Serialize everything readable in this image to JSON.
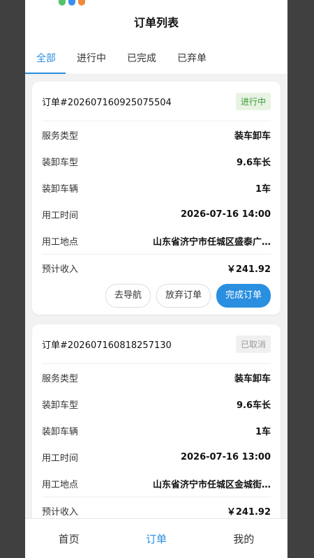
{
  "header": {
    "title": "订单列表"
  },
  "tabs": [
    {
      "label": "全部",
      "active": true
    },
    {
      "label": "进行中",
      "active": false
    },
    {
      "label": "已完成",
      "active": false
    },
    {
      "label": "已弃单",
      "active": false
    }
  ],
  "orders": [
    {
      "order_no": "订单#202607160925075504",
      "status": "进行中",
      "rows": [
        {
          "k": "服务类型",
          "v": "装车卸车"
        },
        {
          "k": "装卸车型",
          "v": "9.6车长"
        },
        {
          "k": "装卸车辆",
          "v": "1车"
        },
        {
          "k": "用工时间",
          "v": "2026-07-16 14:00"
        },
        {
          "k": "用工地点",
          "v": "山东省济宁市任城区盛泰广…"
        },
        {
          "k": "预计收入",
          "v": "￥241.92"
        }
      ],
      "actions": {
        "navigate": "去导航",
        "abandon": "放弃订单",
        "complete": "完成订单"
      }
    },
    {
      "order_no": "订单#202607160818257130",
      "status": "已取消",
      "rows": [
        {
          "k": "服务类型",
          "v": "装车卸车"
        },
        {
          "k": "装卸车型",
          "v": "9.6车长"
        },
        {
          "k": "装卸车辆",
          "v": "1车"
        },
        {
          "k": "用工时间",
          "v": "2026-07-16 13:00"
        },
        {
          "k": "用工地点",
          "v": "山东省济宁市任城区金城街…"
        },
        {
          "k": "预计收入",
          "v": "￥241.92"
        }
      ]
    }
  ],
  "bottom_nav": [
    {
      "label": "首页",
      "active": false
    },
    {
      "label": "订单",
      "active": true
    },
    {
      "label": "我的",
      "active": false
    }
  ],
  "colors": {
    "accent": "#2b8fe0",
    "status_green": "#3a9b34",
    "status_gray": "#9a9a9a"
  }
}
